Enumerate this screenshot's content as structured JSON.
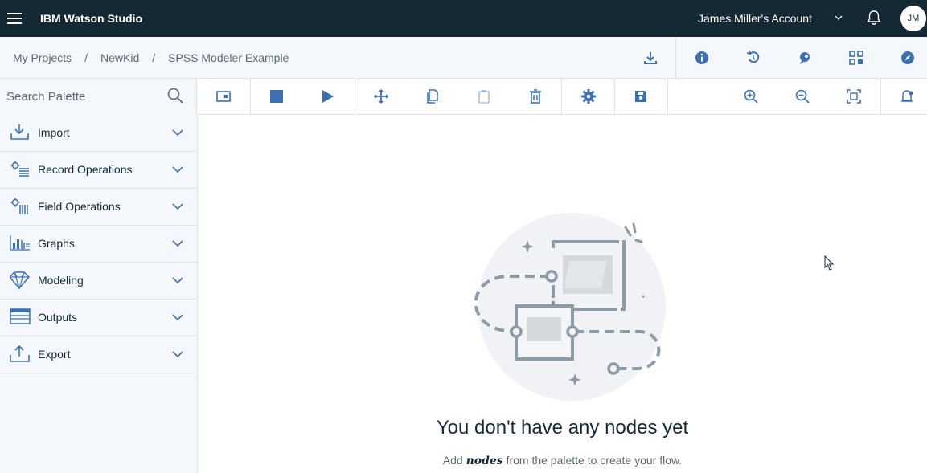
{
  "app": {
    "title": "IBM Watson Studio",
    "account": "James Miller's Account",
    "avatar_initials": "JM"
  },
  "breadcrumb": {
    "items": [
      "My Projects",
      "NewKid",
      "SPSS Modeler Example"
    ],
    "separator": "/"
  },
  "search": {
    "placeholder": "Search Palette"
  },
  "palette": {
    "items": [
      {
        "label": "Import",
        "icon": "import-icon"
      },
      {
        "label": "Record Operations",
        "icon": "record-operations-icon"
      },
      {
        "label": "Field Operations",
        "icon": "field-operations-icon"
      },
      {
        "label": "Graphs",
        "icon": "graphs-icon"
      },
      {
        "label": "Modeling",
        "icon": "modeling-icon"
      },
      {
        "label": "Outputs",
        "icon": "outputs-icon"
      },
      {
        "label": "Export",
        "icon": "export-icon"
      }
    ]
  },
  "empty_state": {
    "title": "You don't have any nodes yet",
    "subtitle_prefix": "Add ",
    "subtitle_emphasis": "nodes",
    "subtitle_suffix": " from the palette to create your flow."
  },
  "colors": {
    "topbar": "#152935",
    "accent": "#3d70b2",
    "panel": "#f4f7fb"
  }
}
